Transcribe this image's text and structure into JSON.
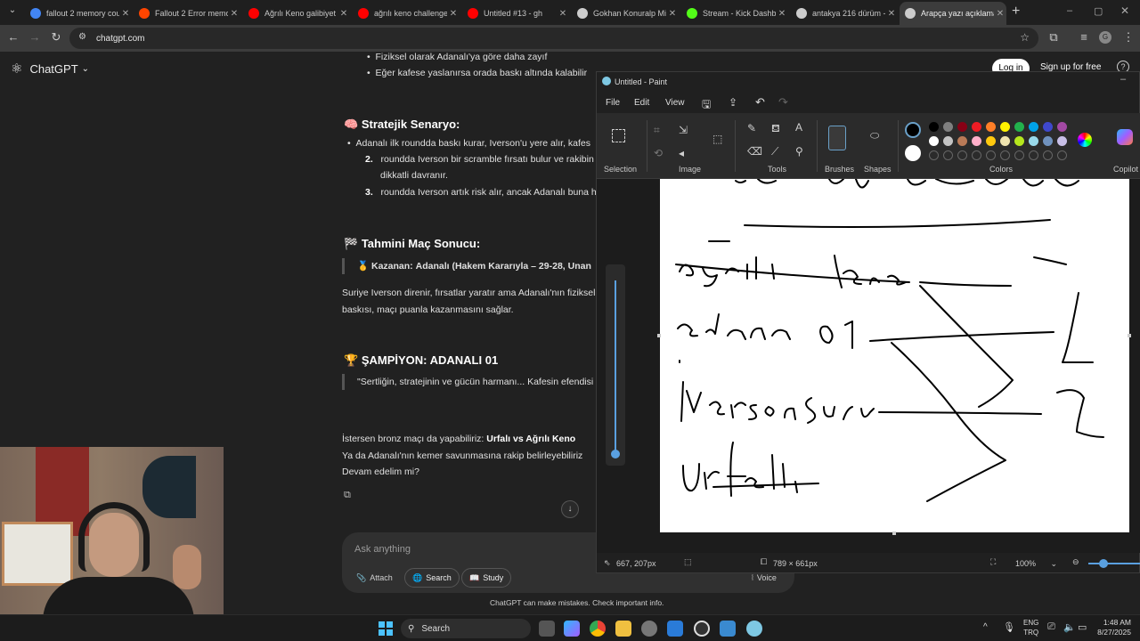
{
  "browser": {
    "tabs": [
      {
        "label": "fallout 2 memory cou",
        "color": "#4285f4"
      },
      {
        "label": "Fallout 2 Error memo",
        "color": "#ff4500"
      },
      {
        "label": "Ağrılı Keno galibiyet",
        "color": "#ff0000"
      },
      {
        "label": "ağrılı keno challenge",
        "color": "#ff0000"
      },
      {
        "label": "Untitled #13 - gh",
        "color": "#ff0000"
      },
      {
        "label": "Gokhan Konuralp Mi",
        "color": "#cccccc"
      },
      {
        "label": "Stream - Kick Dashbo",
        "color": "#53fc18"
      },
      {
        "label": "antakya 216 dürüm -",
        "color": "#cccccc"
      },
      {
        "label": "Arapça yazı açıklama",
        "color": "#cccccc"
      }
    ],
    "url": "chatgpt.com"
  },
  "chatgpt": {
    "brand": "ChatGPT",
    "login": "Log in",
    "signup": "Sign up for free",
    "bullets_top": [
      "Fiziksel olarak Adanalı'ya göre daha zayıf",
      "Eğer kafese yaslanırsa orada baskı altında kalabilir"
    ],
    "strategy_title": "Stratejik Senaryo:",
    "strategy_items": [
      {
        "num": "",
        "text": "Adanalı ilk roundda baskı kurar, Iverson'u yere alır, kafes"
      },
      {
        "num": "2.",
        "text": "roundda Iverson bir scramble fırsatı bulur ve rakibin"
      },
      {
        "num": "",
        "text": "dikkatli davranır."
      },
      {
        "num": "3.",
        "text": "roundda Iverson artık risk alır, ancak Adanalı buna h"
      }
    ],
    "result_title": "Tahmini Maç Sonucu:",
    "winner_label": "Kazanan:",
    "winner_text": "Adanalı (Hakem Kararıyla – 29-28, Unan",
    "summary_line1": "Suriye Iverson direnir, fırsatlar yaratır ama Adanalı'nın fiziksel",
    "summary_line2": "baskısı, maçı puanla kazanmasını sağlar.",
    "champion_title": "ŞAMPİYON: ADANALI 01",
    "champion_quote": "\"Sertliğin, stratejinin ve gücün harmanı... Kafesin efendisi",
    "followup_prefix": "İstersen bronz maçı da yapabiliriz:",
    "followup_bold": "Urfalı vs Ağrılı Keno",
    "followup_line2": "Ya da Adanalı'nın kemer savunmasına rakip belirleyebiliriz",
    "followup_line3": "Devam edelim mi?",
    "ask_placeholder": "Ask anything",
    "attach": "Attach",
    "search": "Search",
    "study": "Study",
    "voice": "Voice",
    "disclaimer": "ChatGPT can make mistakes. Check important info."
  },
  "paint": {
    "title": "Untitled - Paint",
    "menu": [
      "File",
      "Edit",
      "View"
    ],
    "groups": [
      "Selection",
      "Image",
      "Tools",
      "Brushes",
      "Shapes",
      "Colors",
      "Copilot"
    ],
    "palette_row1": [
      "#000000",
      "#7f7f7f",
      "#880015",
      "#ed1c24",
      "#ff7f27",
      "#fff200",
      "#22b14c",
      "#00a2e8",
      "#3f48cc",
      "#a349a4"
    ],
    "palette_row2": [
      "#ffffff",
      "#c3c3c3",
      "#b97a57",
      "#ffaec9",
      "#ffc90e",
      "#efe4b0",
      "#b5e61d",
      "#99d9ea",
      "#7092be",
      "#c8bfe7"
    ],
    "cursor_pos": "667, 207px",
    "canvas_size": "789 × 661px",
    "zoom": "100%"
  },
  "taskbar": {
    "search": "Search",
    "lang1": "ENG",
    "lang2": "TRQ",
    "time": "1:48 AM",
    "date": "8/27/2025"
  }
}
